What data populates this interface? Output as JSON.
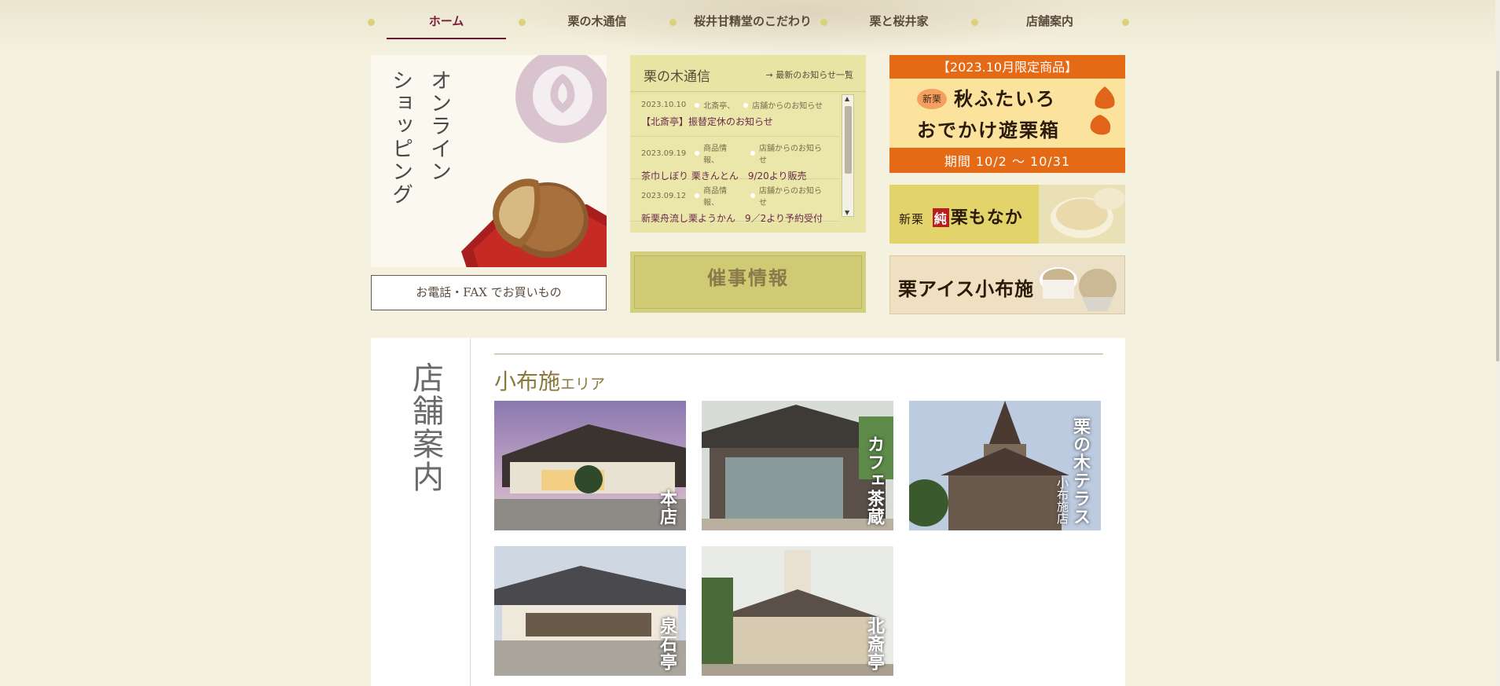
{
  "nav": {
    "items": [
      {
        "label": "ホーム",
        "active": true
      },
      {
        "label": "栗の木通信",
        "active": false
      },
      {
        "label": "桜井甘精堂のこだわり",
        "active": false
      },
      {
        "label": "栗と桜井家",
        "active": false
      },
      {
        "label": "店舗案内",
        "active": false
      }
    ]
  },
  "online_shop": {
    "title_lines": [
      "オンライン",
      "ショッピング"
    ],
    "phone_order_label": "お電話・FAX でお買いもの"
  },
  "news": {
    "title": "栗の木通信",
    "more_link": "最新のお知らせ一覧",
    "items": [
      {
        "date": "2023.10.10",
        "tags": [
          "北斎亭、",
          "店舗からのお知らせ"
        ],
        "text": "【北斎亭】振替定休のお知らせ"
      },
      {
        "date": "2023.09.19",
        "tags": [
          "商品情報、",
          "店舗からのお知らせ"
        ],
        "text": "茶巾しぼり 栗きんとん　9/20より販売"
      },
      {
        "date": "2023.09.12",
        "tags": [
          "商品情報、",
          "店舗からのお知らせ"
        ],
        "text": "新栗舟流し栗ようかん　9／2より予約受付"
      }
    ]
  },
  "event_banner": {
    "label": "催事情報"
  },
  "banners": {
    "limited": {
      "top": "【2023.10月限定商品】",
      "badge": "新栗",
      "line1": "秋ふたいろ",
      "line2": "おでかけ遊栗箱",
      "period": "期間 10/2 ～ 10/31"
    },
    "monaka": {
      "prefix": "新栗",
      "mark": "純",
      "name": "栗もなか"
    },
    "ice": {
      "name": "栗アイス小布施"
    }
  },
  "stores": {
    "section_title": "店舗案内",
    "area_title": "小布施",
    "area_suffix": "エリア",
    "items": [
      {
        "label": "本店"
      },
      {
        "label": "カフェ茶蔵"
      },
      {
        "label": "栗の木テラス",
        "sub": "小布施店"
      },
      {
        "label": "泉石亭"
      },
      {
        "label": "北斎亭"
      }
    ]
  },
  "colors": {
    "accent": "#6a1a34",
    "news_bg": "#e8e4a4",
    "orange": "#e56a16"
  }
}
